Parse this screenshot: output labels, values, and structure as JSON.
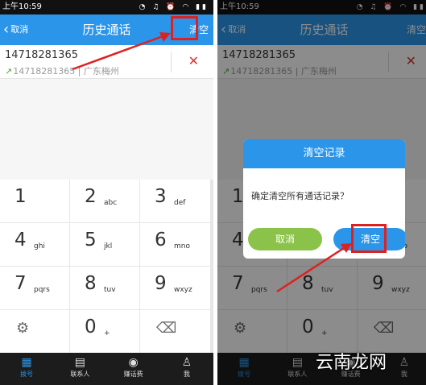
{
  "status": {
    "time": "上午10:59"
  },
  "header": {
    "back": "取消",
    "title": "历史通话",
    "clear": "清空"
  },
  "record": {
    "number": "14718281365",
    "detail": "14718281365 | 广东梅州"
  },
  "keypad": {
    "keys": [
      {
        "d": "1",
        "l": ""
      },
      {
        "d": "2",
        "l": "abc"
      },
      {
        "d": "3",
        "l": "def"
      },
      {
        "d": "4",
        "l": "ghi"
      },
      {
        "d": "5",
        "l": "jkl"
      },
      {
        "d": "6",
        "l": "mno"
      },
      {
        "d": "7",
        "l": "pqrs"
      },
      {
        "d": "8",
        "l": "tuv"
      },
      {
        "d": "9",
        "l": "wxyz"
      },
      {
        "d": "",
        "l": "",
        "icon": "settings-icon"
      },
      {
        "d": "0",
        "l": "+"
      },
      {
        "d": "",
        "l": "",
        "icon": "backspace-icon"
      }
    ]
  },
  "tabs": [
    {
      "label": "拨号",
      "icon": "dialpad-icon"
    },
    {
      "label": "联系人",
      "icon": "contacts-icon"
    },
    {
      "label": "赚话费",
      "icon": "moneybag-icon"
    },
    {
      "label": "我",
      "icon": "person-icon"
    }
  ],
  "dialog": {
    "title": "清空记录",
    "message": "确定清空所有通话记录？",
    "cancel": "取消",
    "confirm": "清空"
  },
  "watermark": "云南龙网",
  "colors": {
    "accent": "#2b95e9",
    "highlight": "#e02020",
    "cancel": "#8bc34a"
  }
}
